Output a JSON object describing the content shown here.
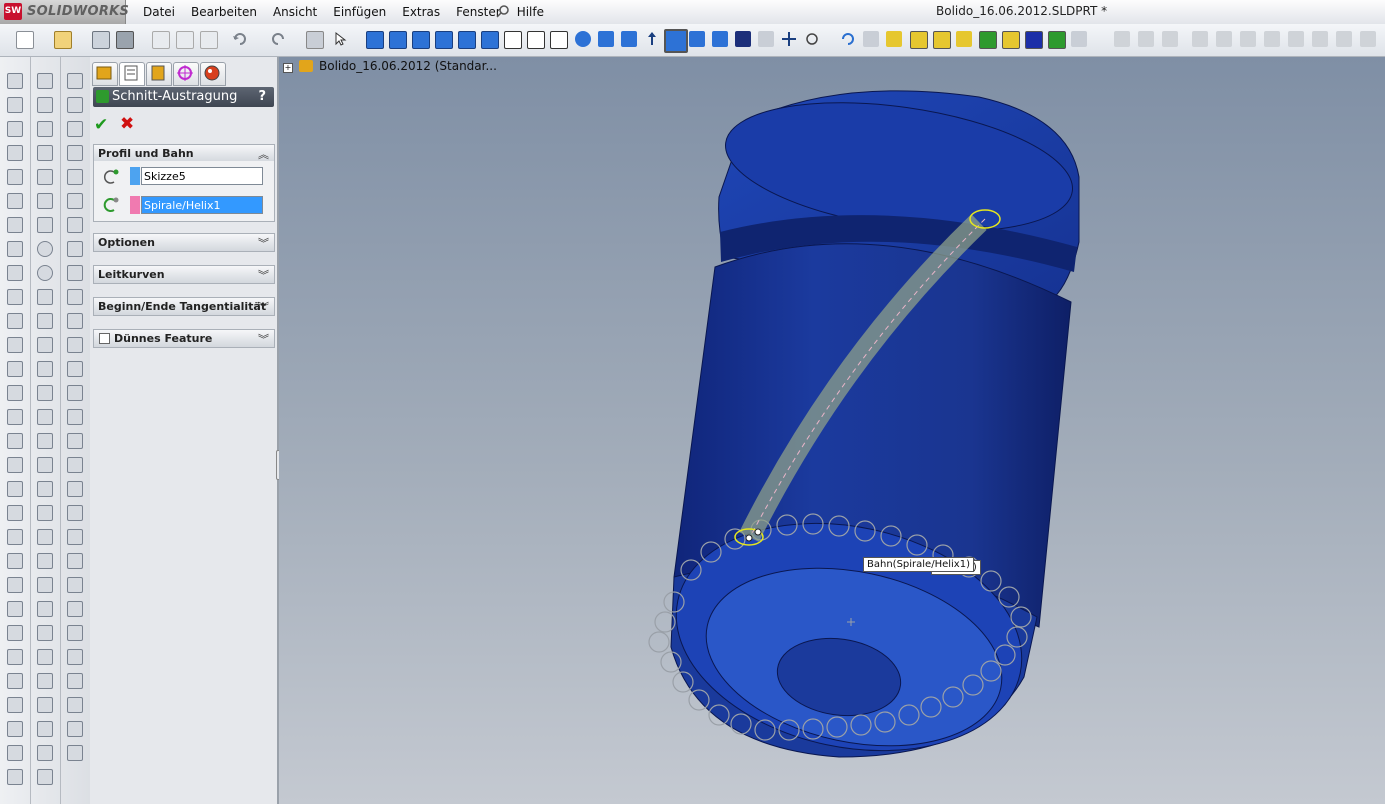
{
  "app": {
    "brand": "SOLIDWORKS",
    "logo_mark": "SW"
  },
  "menu": {
    "items": [
      "Datei",
      "Bearbeiten",
      "Ansicht",
      "Einfügen",
      "Extras",
      "Fenster",
      "Hilfe"
    ]
  },
  "document": {
    "title": "Bolido_16.06.2012.SLDPRT *"
  },
  "panel": {
    "feature_title": "Schnitt-Austragung",
    "help": "?",
    "ok_glyph": "✔",
    "cancel_glyph": "✖",
    "profile_group": {
      "title": "Profil und Bahn",
      "profile_value": "Skizze5",
      "path_value": "Spirale/Helix1",
      "profile_color": "#4da3f0",
      "path_color": "#f07ab0"
    },
    "groups": [
      "Optionen",
      "Leitkurven",
      "Beginn/Ende Tangentialität",
      "Dünnes Feature"
    ]
  },
  "tree": {
    "root_label": "Bolido_16.06.2012  (Standar..."
  },
  "viewport": {
    "tooltip_path": "Bahn(Spirale/Helix1)",
    "tooltip_profile": "Skizze5)",
    "part_color": "#1f3fa8"
  }
}
